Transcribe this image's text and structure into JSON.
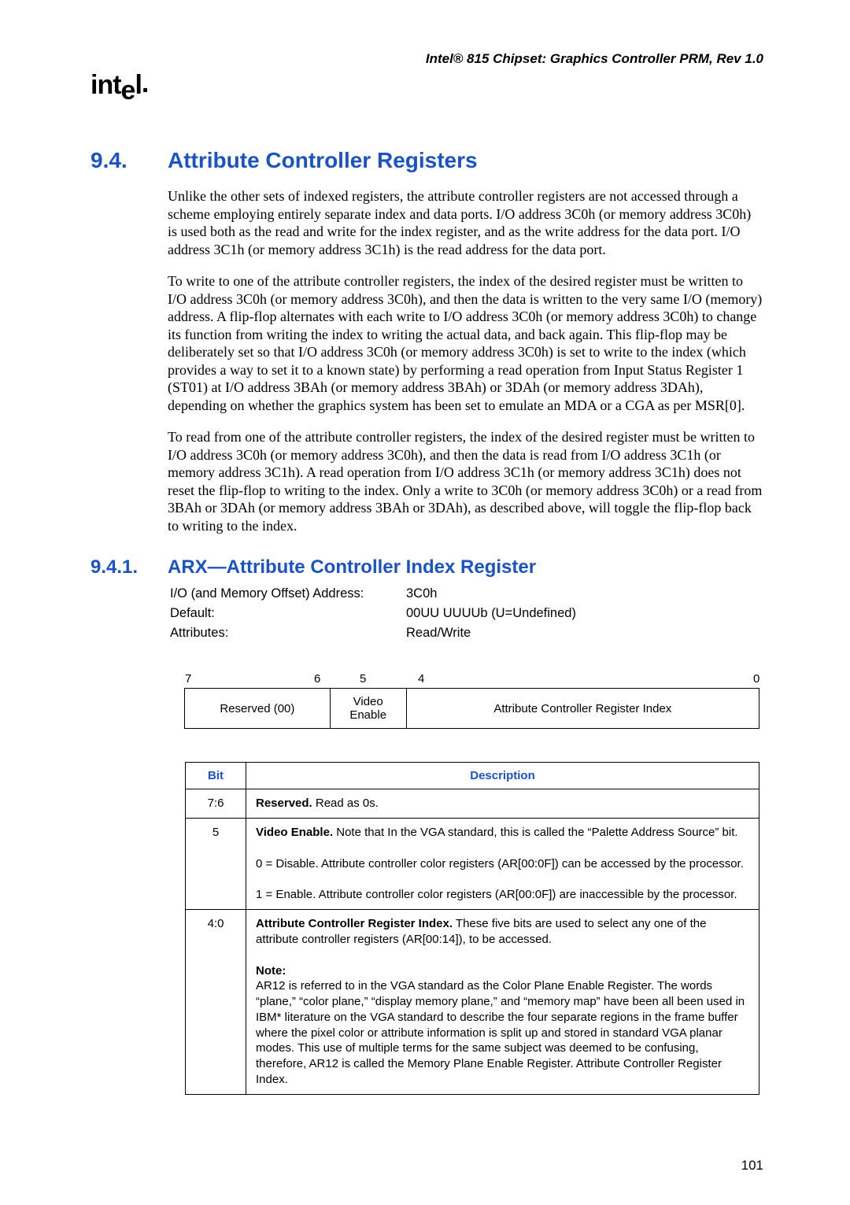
{
  "header": "Intel® 815 Chipset: Graphics Controller PRM, Rev 1.0",
  "logo_text": "intel",
  "section": {
    "number": "9.4.",
    "title": "Attribute Controller Registers",
    "p1": "Unlike the other sets of indexed registers, the attribute controller registers are not accessed through a scheme employing entirely separate index and data ports. I/O address 3C0h (or memory address 3C0h) is used both as the read and write for the index register, and as the write address for the data port. I/O address 3C1h (or memory address 3C1h) is the read address for the data port.",
    "p2": "To write to one of the attribute controller registers, the index of the desired register must be written to I/O address 3C0h (or memory address 3C0h), and then the data is written to the very same I/O (memory) address. A flip-flop alternates with each write to I/O address 3C0h (or memory address 3C0h) to change its function from writing the index to writing the actual data, and back again. This flip-flop may be deliberately set so that I/O address 3C0h (or memory address 3C0h) is set to write to the index (which provides a way to set it to a known state) by performing a read operation from Input Status Register 1 (ST01) at I/O address 3BAh (or memory address 3BAh) or 3DAh (or memory address 3DAh), depending on whether the graphics system has been set to emulate an MDA or a CGA as per MSR[0].",
    "p3": "To read from one of the attribute controller registers, the index of the desired register must be written to I/O address 3C0h (or memory address 3C0h), and then the data is read from I/O address 3C1h (or memory address 3C1h). A read operation from I/O address 3C1h (or memory address 3C1h) does not reset the flip-flop to writing to the index. Only a write to 3C0h (or memory address 3C0h) or a read from 3BAh or 3DAh (or memory address 3BAh or 3DAh), as described above, will toggle the flip-flop back to writing to the index."
  },
  "subsection": {
    "number": "9.4.1.",
    "title": "ARX—Attribute Controller Index Register",
    "props": [
      {
        "label": "I/O (and Memory Offset) Address:",
        "value": "3C0h"
      },
      {
        "label": "Default:",
        "value": "00UU UUUUb (U=Undefined)"
      },
      {
        "label": "Attributes:",
        "value": "Read/Write"
      }
    ]
  },
  "bit_diagram": {
    "ticks": [
      {
        "pos": 0,
        "label": "7"
      },
      {
        "pos": 164,
        "label": "6"
      },
      {
        "pos": 222,
        "label": "5"
      },
      {
        "pos": 296,
        "label": "4"
      },
      {
        "pos": 722,
        "label": "0"
      }
    ],
    "cells": [
      {
        "label": "Reserved (00)",
        "flex": 2
      },
      {
        "label": "Video\nEnable",
        "flex": 1
      },
      {
        "label": "Attribute Controller Register Index",
        "flex": 5
      }
    ]
  },
  "desc_table": {
    "headers": [
      "Bit",
      "Description"
    ],
    "rows": [
      {
        "bit": "7:6",
        "html": "<strong>Reserved.</strong> Read as 0s."
      },
      {
        "bit": "5",
        "html": "<strong>Video Enable.</strong> Note that In the VGA standard, this is called the “Palette Address Source” bit.<br><br>0 = Disable. Attribute controller color registers (AR[00:0F]) can be accessed by the processor.<br><br>1 = Enable. Attribute controller color registers (AR[00:0F]) are inaccessible by the processor."
      },
      {
        "bit": "4:0",
        "html": "<strong>Attribute Controller Register Index.</strong> These five bits are used to select any one of the attribute controller registers (AR[00:14]), to be accessed.<br><br><strong>Note:</strong><br>AR12 is referred to in the VGA standard as the Color Plane Enable Register. The words “plane,” “color plane,” “display memory plane,” and “memory map” have been all been used in IBM* literature on the VGA standard to describe the four separate regions in the frame buffer where the pixel color or attribute information is split up and stored in standard VGA planar modes. This use of multiple terms for the same subject was deemed to be confusing, therefore, AR12 is called the Memory Plane Enable Register. Attribute Controller Register Index."
      }
    ]
  },
  "page_number": "101"
}
